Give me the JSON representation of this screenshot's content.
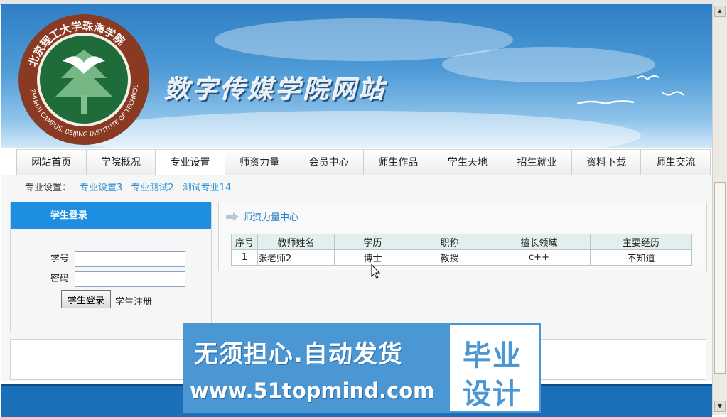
{
  "header": {
    "logo_ring_text": "北京理工大学珠海学院 ZHUHAI CAMPUS, BEIJING INSTITUTE OF TECHNOLOGY",
    "site_title": "数字传媒学院网站"
  },
  "nav": {
    "items": [
      {
        "label": "网站首页"
      },
      {
        "label": "学院概况"
      },
      {
        "label": "专业设置"
      },
      {
        "label": "师资力量"
      },
      {
        "label": "会员中心"
      },
      {
        "label": "师生作品"
      },
      {
        "label": "学生天地"
      },
      {
        "label": "招生就业"
      },
      {
        "label": "资料下载"
      },
      {
        "label": "师生交流"
      }
    ]
  },
  "breadcrumb": {
    "prefix": "专业设置：",
    "links": [
      {
        "label": "专业设置3"
      },
      {
        "label": "专业测试2"
      },
      {
        "label": "测试专业14"
      }
    ]
  },
  "login": {
    "title": "学生登录",
    "id_label": "学号",
    "id_value": "",
    "pwd_label": "密码",
    "pwd_value": "",
    "login_button": "学生登录",
    "register_link": "学生注册"
  },
  "faculty": {
    "title": "师资力量中心",
    "table": {
      "headers": [
        "序号",
        "教师姓名",
        "学历",
        "职称",
        "擅长领域",
        "主要经历"
      ],
      "rows": [
        [
          "1",
          "张老师2",
          "博士",
          "教授",
          "c++",
          "不知道"
        ]
      ]
    }
  },
  "watermark": {
    "slogan": "无须担心.自动发货",
    "url": "www.51topmind.com",
    "badge_line1": "毕业",
    "badge_line2": "设计"
  },
  "colors": {
    "header_blue": "#2f7fc5",
    "login_head": "#1e8fe0",
    "link_blue": "#2f8fd6",
    "footer_blue": "#1b6fb8",
    "watermark_blue": "#4a97d4"
  }
}
